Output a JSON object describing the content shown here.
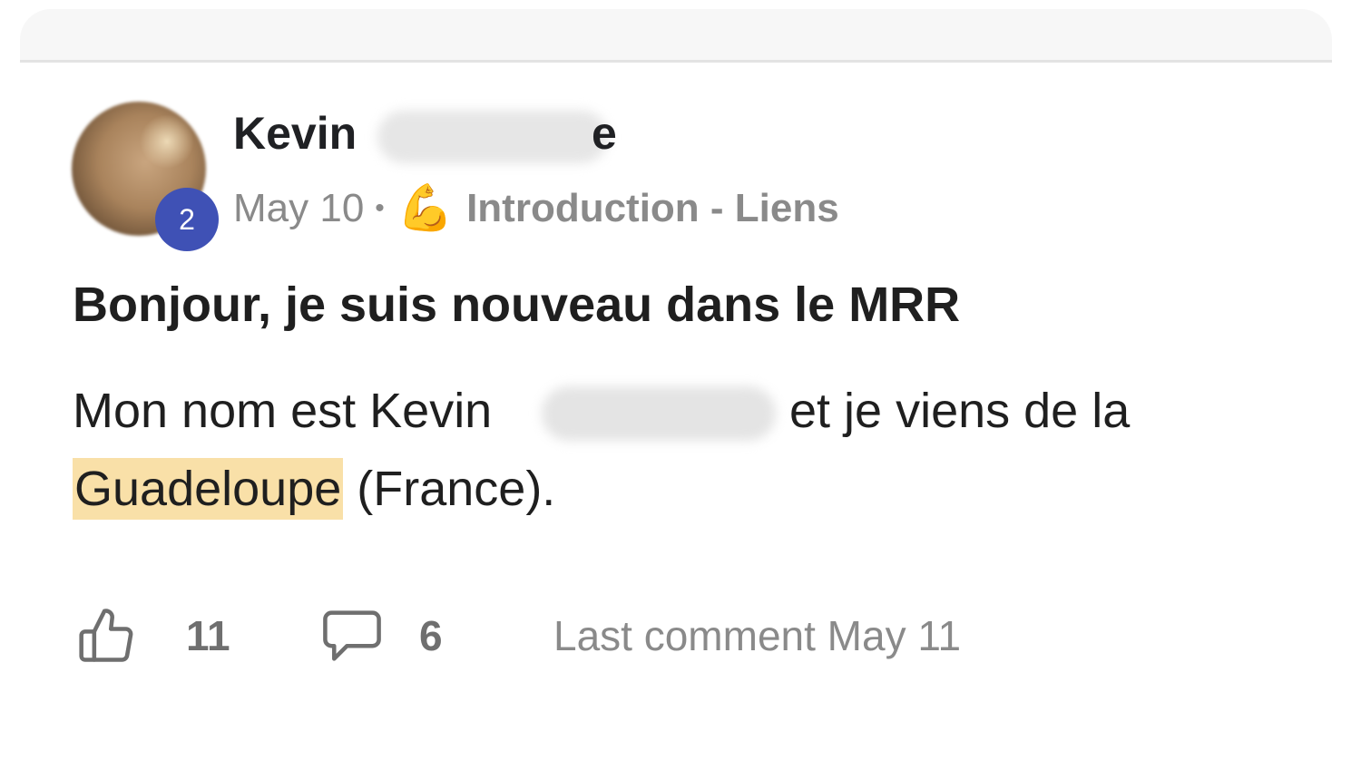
{
  "post": {
    "author": {
      "name_visible_start": "Kevin",
      "name_visible_end": "e",
      "level": "2"
    },
    "date": "May 10",
    "separator": "•",
    "category_icon": "flexed-biceps-emoji",
    "category": "Introduction - Liens",
    "title": "Bonjour, je suis nouveau dans le MRR",
    "body": {
      "line1_start": "Mon nom est Kevin",
      "line1_end": "et je viens de la",
      "highlighted_word": "Guadeloupe",
      "line2_rest": "(France)."
    },
    "stats": {
      "likes": "11",
      "comments": "6",
      "last_comment": "Last comment May 11"
    },
    "colors": {
      "badge": "#3f51b5",
      "highlight": "#f9e0a8",
      "muted_text": "#8a8a8a"
    }
  }
}
